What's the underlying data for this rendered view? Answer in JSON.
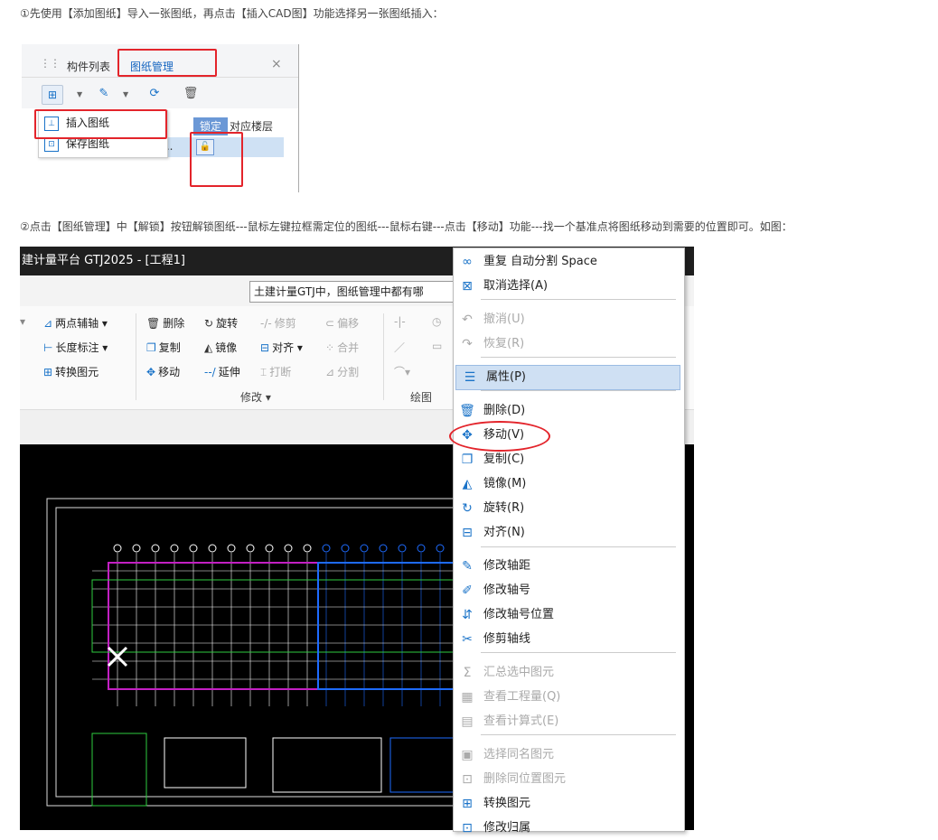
{
  "step1": "①先使用【添加图纸】导入一张图纸，再点击【插入CAD图】功能选择另一张图纸插入：",
  "step2": "②点击【图纸管理】中【解锁】按钮解锁图纸---鼠标左键拉框需定位的图纸---鼠标右键---点击【移动】功能---找一个基准点将图纸移动到需要的位置即可。如图：",
  "panel1": {
    "tabs": [
      "构件列表",
      "图纸管理"
    ],
    "close": "×",
    "menu": [
      "插入图纸",
      "保存图纸"
    ],
    "columns": [
      "锁定",
      "对应楼层"
    ],
    "row_text": "..."
  },
  "panel2": {
    "title": "建计量平台 GTJ2025 - [工程1]",
    "search": "土建计量GTJ中，图纸管理中都有哪",
    "ribbon": {
      "aux": [
        "两点辅轴",
        "长度标注",
        "转换图元"
      ],
      "modify_col1": [
        "删除",
        "复制",
        "移动"
      ],
      "modify_col2": [
        "旋转",
        "镜像",
        "延伸"
      ],
      "modify_col3": [
        "修剪",
        "对齐",
        "打断"
      ],
      "modify_col4": [
        "偏移",
        "合并",
        "分割"
      ],
      "modify_label": "修改",
      "draw_label": "绘图"
    }
  },
  "context_menu": [
    {
      "icon": "repeat-icon",
      "label": "重复 自动分割   Space",
      "enabled": true
    },
    {
      "icon": "cancel-select-icon",
      "label": "取消选择(A)",
      "enabled": true
    },
    {
      "icon": "undo-icon",
      "label": "撤消(U)",
      "enabled": false
    },
    {
      "icon": "redo-icon",
      "label": "恢复(R)",
      "enabled": false
    },
    {
      "icon": "properties-icon",
      "label": "属性(P)",
      "enabled": true,
      "highlight": true
    },
    {
      "icon": "delete-icon",
      "label": "删除(D)",
      "enabled": true
    },
    {
      "icon": "move-icon",
      "label": "移动(V)",
      "enabled": true
    },
    {
      "icon": "copy-icon",
      "label": "复制(C)",
      "enabled": true
    },
    {
      "icon": "mirror-icon",
      "label": "镜像(M)",
      "enabled": true
    },
    {
      "icon": "rotate-icon",
      "label": "旋转(R)",
      "enabled": true
    },
    {
      "icon": "align-icon",
      "label": "对齐(N)",
      "enabled": true
    },
    {
      "icon": "edit-axis-spacing-icon",
      "label": "修改轴距",
      "enabled": true
    },
    {
      "icon": "edit-axis-number-icon",
      "label": "修改轴号",
      "enabled": true
    },
    {
      "icon": "edit-axis-number-position-icon",
      "label": "修改轴号位置",
      "enabled": true
    },
    {
      "icon": "trim-axis-icon",
      "label": "修剪轴线",
      "enabled": true
    },
    {
      "icon": "sum-selected-icon",
      "label": "汇总选中图元",
      "enabled": false
    },
    {
      "icon": "view-quantity-icon",
      "label": "查看工程量(Q)",
      "enabled": false
    },
    {
      "icon": "view-formula-icon",
      "label": "查看计算式(E)",
      "enabled": false
    },
    {
      "icon": "select-same-name-icon",
      "label": "选择同名图元",
      "enabled": false
    },
    {
      "icon": "delete-same-position-icon",
      "label": "删除同位置图元",
      "enabled": false
    },
    {
      "icon": "convert-icon",
      "label": "转换图元",
      "enabled": true
    },
    {
      "icon": "edit-attribution-icon",
      "label": "修改归属",
      "enabled": true
    }
  ]
}
